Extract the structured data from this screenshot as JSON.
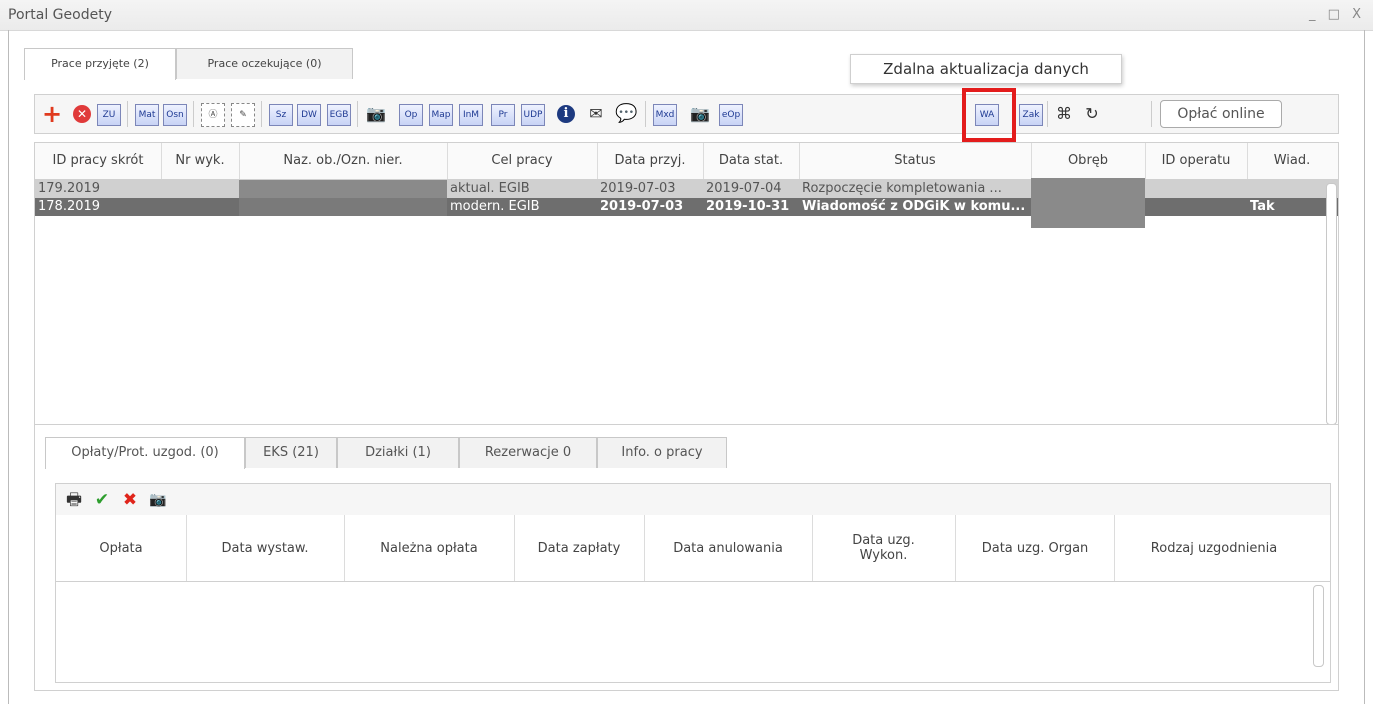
{
  "window": {
    "title": "Portal Geodety",
    "controls": "_ □ X"
  },
  "top_tabs": [
    {
      "label": "Prace przyjęte (2)"
    },
    {
      "label": "Prace oczekujące (0)"
    }
  ],
  "tooltip": "Zdalna aktualizacja danych",
  "toolbar": {
    "zu": "ZU",
    "mat": "Mat",
    "osn": "Osn",
    "sz": "Sz",
    "dw": "DW",
    "egb": "EGB",
    "op": "Op",
    "map": "Map",
    "inm": "InM",
    "pr": "Pr",
    "udp": "UDP",
    "mxd": "Mxd",
    "eop": "eOp",
    "wa": "WA",
    "zak": "Zak",
    "pay_online": "Opłać online"
  },
  "grid": {
    "columns": [
      "ID pracy skrót",
      "Nr wyk.",
      "Naz. ob./Ozn. nier.",
      "Cel pracy",
      "Data przyj.",
      "Data stat.",
      "Status",
      "Obręb",
      "ID operatu",
      "Wiad."
    ],
    "rows": [
      {
        "id": "179.2019",
        "nr": "",
        "naz": "",
        "cel": "aktual. EGIB",
        "przyj": "2019-07-03",
        "stat": "2019-07-04",
        "status": "Rozpoczęcie kompletowania ...",
        "obreb": "",
        "operat": "",
        "wiad": ""
      },
      {
        "id": "178.2019",
        "nr": "",
        "naz": "",
        "cel": "modern. EGIB",
        "przyj": "2019-07-03",
        "stat": "2019-10-31",
        "status": "Wiadomość z ODGiK w komu...",
        "obreb": "",
        "operat": "",
        "wiad": "Tak"
      }
    ]
  },
  "bottom_tabs": [
    {
      "label": "Opłaty/Prot. uzgod. (0)"
    },
    {
      "label": "EKS (21)"
    },
    {
      "label": "Działki (1)"
    },
    {
      "label": "Rezerwacje 0"
    },
    {
      "label": "Info. o pracy"
    }
  ],
  "payments": {
    "columns": [
      "Opłata",
      "Data wystaw.",
      "Należna opłata",
      "Data zapłaty",
      "Data anulowania",
      "Data uzg. Wykon.",
      "Data uzg. Organ",
      "Rodzaj uzgodnienia"
    ]
  },
  "colors": {
    "highlight": "#e31c1c",
    "selected_row": "#6e6e6e",
    "row": "#d0d0d0"
  }
}
